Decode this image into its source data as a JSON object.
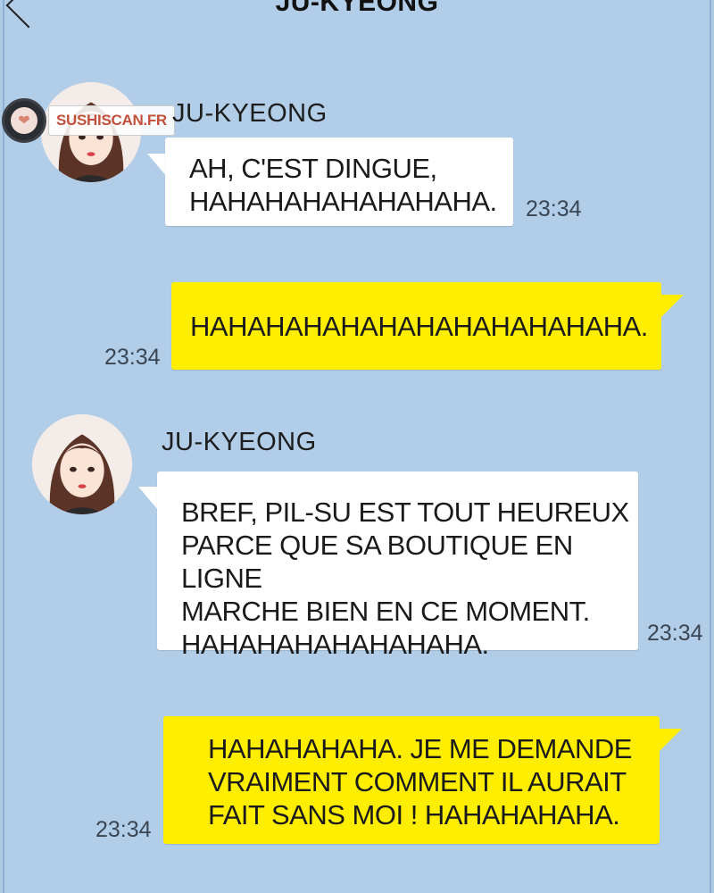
{
  "header": {
    "title": "JU-KYEONG"
  },
  "watermark": {
    "label": "SUSHISCAN.FR",
    "icon": "heart-icon"
  },
  "messages": [
    {
      "sender": "JU-KYEONG",
      "side": "left",
      "text": "AH, C'EST DINGUE,\nHAHAHAHAHAHAHAHA.",
      "time": "23:34"
    },
    {
      "side": "right",
      "text": "HAHAHAHAHAHAHAHAHAHAHAHA.",
      "time": "23:34"
    },
    {
      "sender": "JU-KYEONG",
      "side": "left",
      "text": "BREF, PIL-SU EST TOUT HEUREUX\nPARCE QUE SA BOUTIQUE EN LIGNE\nMARCHE BIEN EN CE MOMENT.\nHAHAHAHAHAHAHAHA.",
      "time": "23:34"
    },
    {
      "side": "right",
      "text": "HAHAHAHAHA. JE ME DEMANDE\nVRAIMENT COMMENT IL AURAIT\nFAIT SANS MOI ! HAHAHAHAHA.",
      "time": "23:34"
    }
  ],
  "colors": {
    "background": "#b1cde8",
    "outgoing_bubble": "#ffee00",
    "incoming_bubble": "#ffffff"
  }
}
